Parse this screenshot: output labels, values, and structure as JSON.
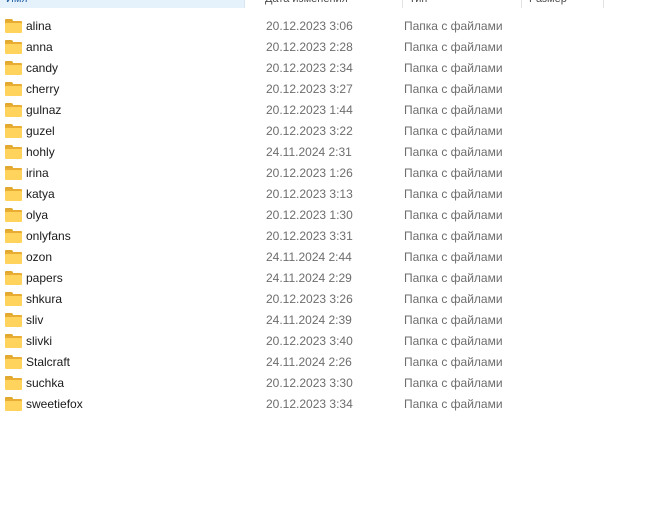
{
  "columns": {
    "name": "Имя",
    "date": "Дата изменения",
    "type": "Тип",
    "size": "Размер"
  },
  "files": [
    {
      "name": "alina",
      "date": "20.12.2023 3:06",
      "type": "Папка с файлами",
      "size": ""
    },
    {
      "name": "anna",
      "date": "20.12.2023 2:28",
      "type": "Папка с файлами",
      "size": ""
    },
    {
      "name": "candy",
      "date": "20.12.2023 2:34",
      "type": "Папка с файлами",
      "size": ""
    },
    {
      "name": "cherry",
      "date": "20.12.2023 3:27",
      "type": "Папка с файлами",
      "size": ""
    },
    {
      "name": "gulnaz",
      "date": "20.12.2023 1:44",
      "type": "Папка с файлами",
      "size": ""
    },
    {
      "name": "guzel",
      "date": "20.12.2023 3:22",
      "type": "Папка с файлами",
      "size": ""
    },
    {
      "name": "hohly",
      "date": "24.11.2024 2:31",
      "type": "Папка с файлами",
      "size": ""
    },
    {
      "name": "irina",
      "date": "20.12.2023 1:26",
      "type": "Папка с файлами",
      "size": ""
    },
    {
      "name": "katya",
      "date": "20.12.2023 3:13",
      "type": "Папка с файлами",
      "size": ""
    },
    {
      "name": "olya",
      "date": "20.12.2023 1:30",
      "type": "Папка с файлами",
      "size": ""
    },
    {
      "name": "onlyfans",
      "date": "20.12.2023 3:31",
      "type": "Папка с файлами",
      "size": ""
    },
    {
      "name": "ozon",
      "date": "24.11.2024 2:44",
      "type": "Папка с файлами",
      "size": ""
    },
    {
      "name": "papers",
      "date": "24.11.2024 2:29",
      "type": "Папка с файлами",
      "size": ""
    },
    {
      "name": "shkura",
      "date": "20.12.2023 3:26",
      "type": "Папка с файлами",
      "size": ""
    },
    {
      "name": "sliv",
      "date": "24.11.2024 2:39",
      "type": "Папка с файлами",
      "size": ""
    },
    {
      "name": "slivki",
      "date": "20.12.2023 3:40",
      "type": "Папка с файлами",
      "size": ""
    },
    {
      "name": "Stalcraft",
      "date": "24.11.2024 2:26",
      "type": "Папка с файлами",
      "size": ""
    },
    {
      "name": "suchka",
      "date": "20.12.2023 3:30",
      "type": "Папка с файлами",
      "size": ""
    },
    {
      "name": "sweetiefox",
      "date": "20.12.2023 3:34",
      "type": "Папка с файлами",
      "size": ""
    }
  ],
  "icon": "folder-icon",
  "colors": {
    "folder": "#ffd35c",
    "header_selected": "#e5f1fb"
  }
}
